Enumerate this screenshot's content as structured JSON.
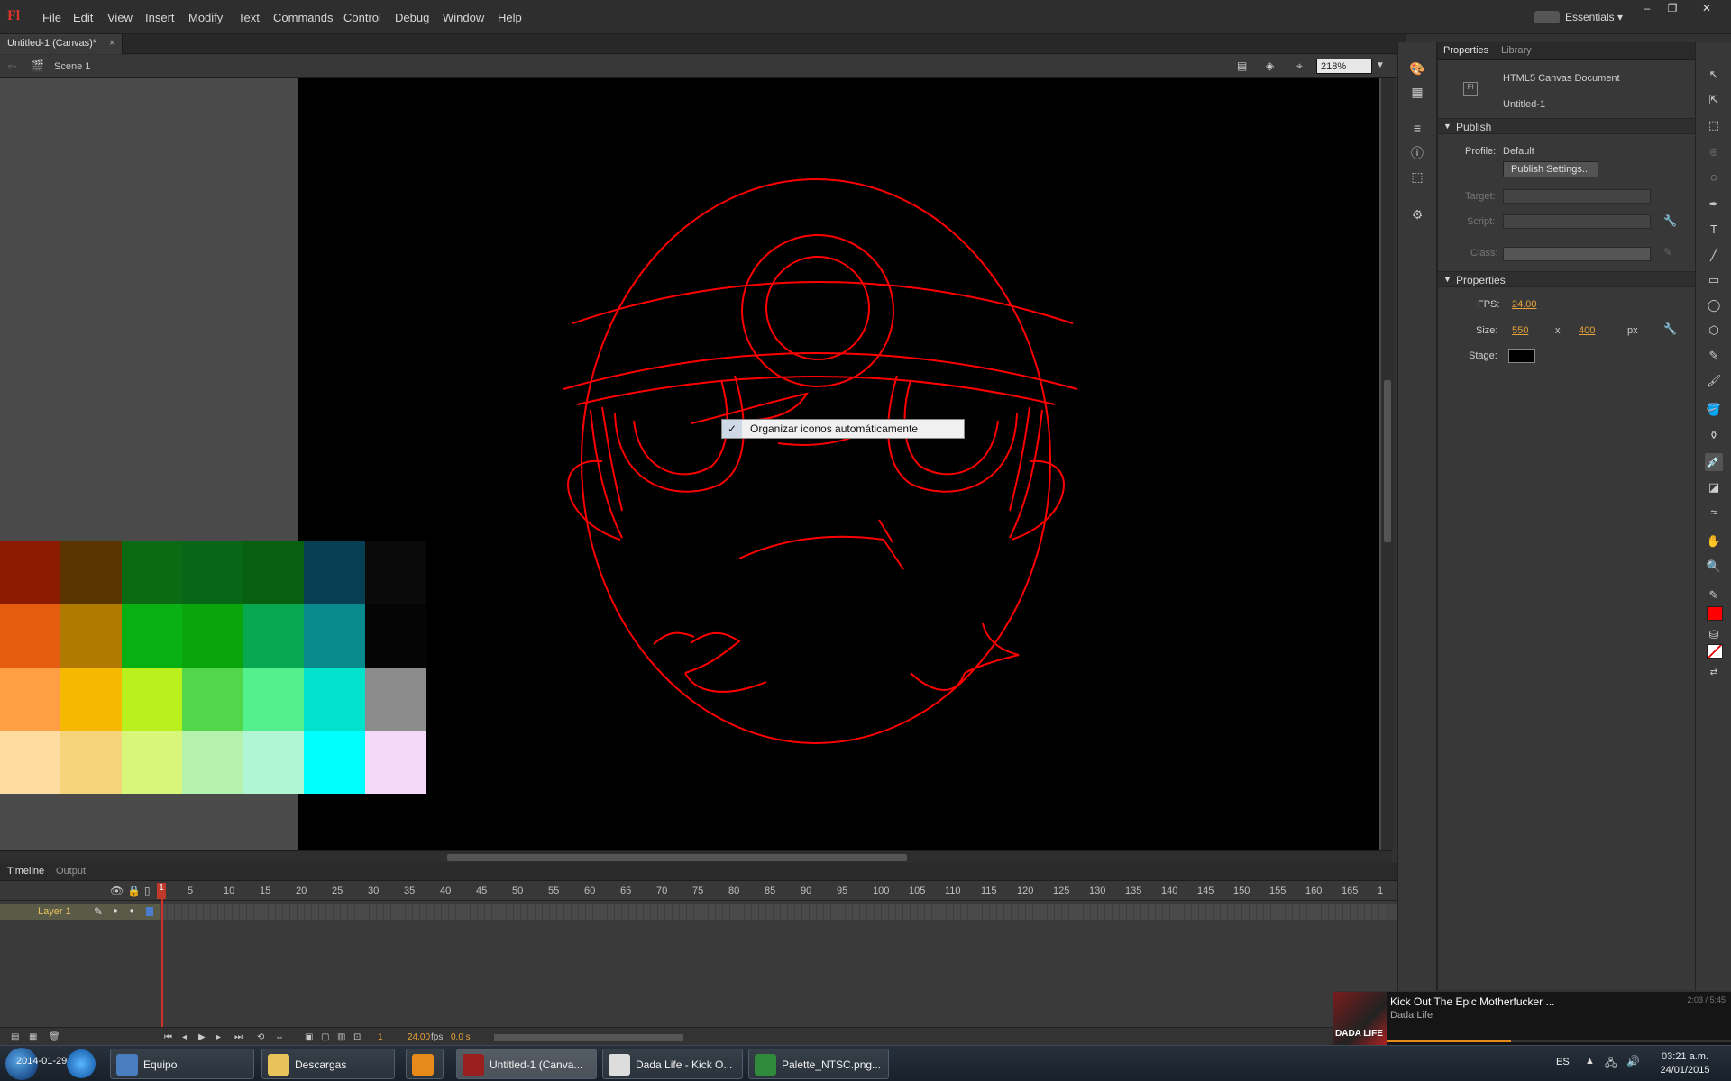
{
  "app": {
    "logo": "Fl",
    "menu": [
      "File",
      "Edit",
      "View",
      "Insert",
      "Modify",
      "Text",
      "Commands",
      "Control",
      "Debug",
      "Window",
      "Help"
    ],
    "workspace": "Essentials",
    "window_controls": [
      "–",
      "❐",
      "✕"
    ]
  },
  "document": {
    "tab_title": "Untitled-1 (Canvas)*",
    "tab_close": "×",
    "scene": "Scene 1",
    "zoom": "218%"
  },
  "context_menu": {
    "check": "✓",
    "label": "Organizar iconos automáticamente"
  },
  "palette_colors": [
    "#8b1a00",
    "#5a3500",
    "#0b6a14",
    "#086618",
    "#066010",
    "#063e52",
    "#0a0a0a",
    "#e55d10",
    "#b07a00",
    "#09b013",
    "#0aa40b",
    "#07a850",
    "#088a8c",
    "#050505",
    "#ff9e44",
    "#f7b800",
    "#b9f01e",
    "#52d64c",
    "#55f08e",
    "#00e2cc",
    "#8c8c8c",
    "#ffdca2",
    "#f5d47a",
    "#d8f77a",
    "#b4f2ad",
    "#b0f6d4",
    "#00ffff",
    "#f4d8f8"
  ],
  "timeline": {
    "tabs": [
      "Timeline",
      "Output"
    ],
    "layer_name": "Layer 1",
    "frame_numbers": [
      "1",
      "5",
      "10",
      "15",
      "20",
      "25",
      "30",
      "35",
      "40",
      "45",
      "50",
      "55",
      "60",
      "65",
      "70",
      "75",
      "80",
      "85",
      "90",
      "95",
      "100",
      "105",
      "110",
      "115",
      "120",
      "125",
      "130",
      "135",
      "140",
      "145",
      "150",
      "155",
      "160",
      "165",
      "1"
    ],
    "current_frame": "1",
    "fps": "24.00",
    "fps_unit": "fps",
    "time": "0.0 s"
  },
  "properties": {
    "tabs": [
      "Properties",
      "Library"
    ],
    "doc_type": "HTML5 Canvas Document",
    "doc_name": "Untitled-1",
    "publish_header": "Publish",
    "profile_label": "Profile:",
    "profile_value": "Default",
    "publish_settings_btn": "Publish Settings...",
    "target_label": "Target:",
    "script_label": "Script:",
    "class_label": "Class:",
    "props_header": "Properties",
    "fps_label": "FPS:",
    "fps_value": "24.00",
    "size_label": "Size:",
    "width": "550",
    "x": "x",
    "height": "400",
    "unit": "px",
    "stage_label": "Stage:",
    "stage_color": "#000000"
  },
  "media_notification": {
    "title": "Kick Out The Epic Motherfucker ...",
    "artist": "Dada Life",
    "time": "2:03 / 5:45",
    "art_label": "DADA LIFE",
    "progress": 0.36
  },
  "taskbar": {
    "overlay_text": "2014-01-29-1...",
    "apps": [
      {
        "label": "Equipo",
        "color": "#4a7cc0"
      },
      {
        "label": "Descargas",
        "color": "#e8c35a"
      },
      {
        "label": "",
        "color": "#e88a1a"
      },
      {
        "label": "Untitled-1 (Canva...",
        "color": "#9a1f1f"
      },
      {
        "label": "Dada Life - Kick O...",
        "color": "#dddddd"
      },
      {
        "label": "Palette_NTSC.png...",
        "color": "#2f8a3c"
      }
    ],
    "lang": "ES",
    "time": "03:21 a.m.",
    "date": "24/01/2015"
  },
  "colors": {
    "accent_orange": "#e8a33a",
    "drawing_stroke": "#ff0000",
    "playhead": "#d4302a"
  }
}
